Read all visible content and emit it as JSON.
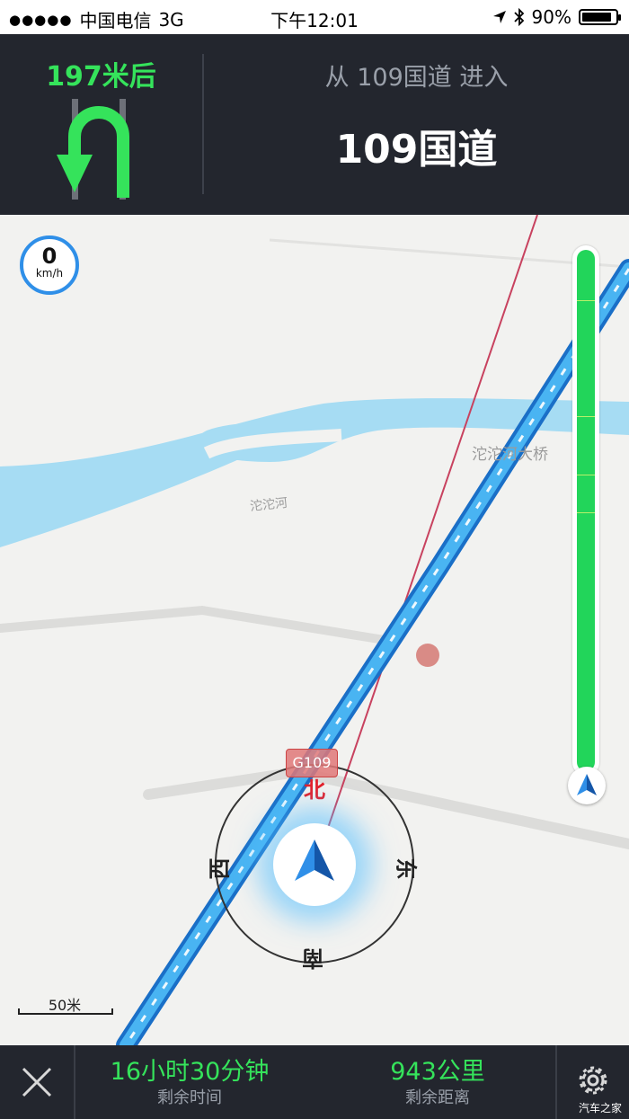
{
  "status_bar": {
    "carrier": "中国电信",
    "network": "3G",
    "time": "下午12:01",
    "battery": "90%",
    "battery_level": 0.9
  },
  "nav": {
    "distance": "197米后",
    "maneuver_icon": "u-turn-icon",
    "enter_text": "从 109国道 进入",
    "road_name": "109国道"
  },
  "map": {
    "speed_value": "0",
    "speed_unit": "km/h",
    "bridge_label": "沱沱河大桥",
    "river_label": "沱沱河",
    "road_tag": "G109",
    "compass": {
      "north": "北",
      "south": "南",
      "east": "东",
      "west": "西"
    },
    "scale_label": "50米",
    "route_progress": 1.0
  },
  "bottom_bar": {
    "time_value": "16小时30分钟",
    "time_label": "剩余时间",
    "distance_value": "943公里",
    "distance_label": "剩余距离",
    "watermark": "汽车之家"
  },
  "colors": {
    "header_bg": "#23262e",
    "accent_green": "#35e35b",
    "route_blue": "#2f8fe8",
    "water": "#a6dcf3",
    "map_bg": "#f2f2f0"
  }
}
